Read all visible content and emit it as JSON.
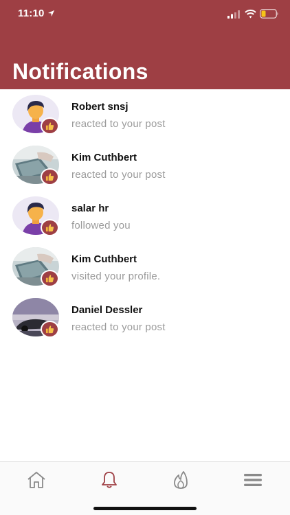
{
  "status_bar": {
    "time": "11:10"
  },
  "header": {
    "title": "Notifications"
  },
  "notifications": [
    {
      "name": "Robert snsj",
      "message": "reacted to your post",
      "avatar": "cartoon-man-avatar"
    },
    {
      "name": "Kim Cuthbert",
      "message": "reacted to your post",
      "avatar": "laptop-photo-avatar"
    },
    {
      "name": "salar hr",
      "message": "followed you",
      "avatar": "cartoon-man-avatar"
    },
    {
      "name": "Kim Cuthbert",
      "message": "visited your profile.",
      "avatar": "laptop-photo-avatar"
    },
    {
      "name": "Daniel Dessler",
      "message": "reacted to your post",
      "avatar": "car-photo-avatar"
    }
  ],
  "badge_icon": "thumbs-up-icon",
  "tabs": [
    {
      "icon": "home-icon",
      "active": false
    },
    {
      "icon": "bell-icon",
      "active": true
    },
    {
      "icon": "flame-icon",
      "active": false
    },
    {
      "icon": "menu-icon",
      "active": false
    }
  ],
  "colors": {
    "brand": "#9e3f44",
    "active_tab": "#9e3f44",
    "inactive_tab": "#8a8a8a",
    "secondary_text": "#9a9a9a"
  }
}
